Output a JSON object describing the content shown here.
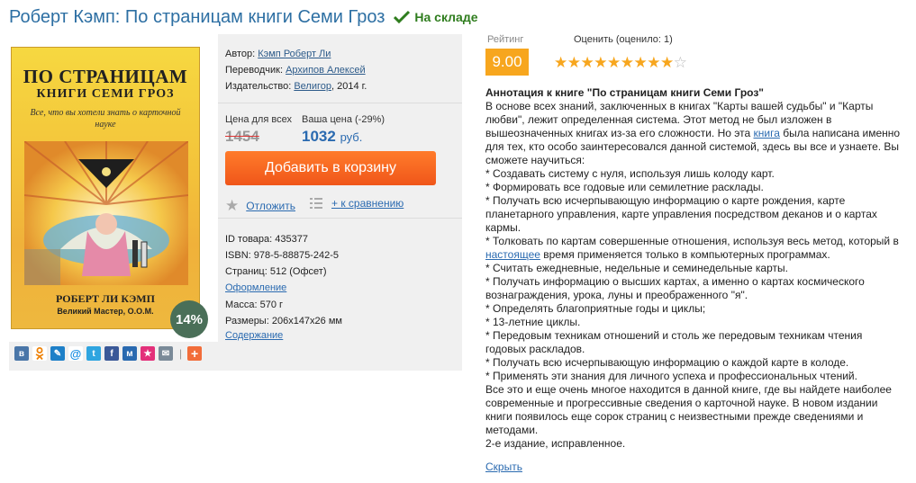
{
  "header": {
    "title": "Роберт Кэмп: По страницам книги Семи Гроз",
    "stock_status": "На складе",
    "stock_color": "#2f7d1e"
  },
  "cover": {
    "title_line1": "ПО СТРАНИЦАМ",
    "title_line2": "КНИГИ СЕМИ ГРОЗ",
    "subtitle": "Все, что вы хотели знать о карточной науке",
    "author": "РОБЕРТ ЛИ КЭМП",
    "author_title": "Великий Мастер, О.О.М.",
    "discount": "14%"
  },
  "details": {
    "author_label": "Автор:",
    "author_value": "Кэмп Роберт Ли",
    "translator_label": "Переводчик:",
    "translator_value": "Архипов Алексей",
    "publisher_label": "Издательство:",
    "publisher_value": "Велигор",
    "publisher_year": ", 2014 г."
  },
  "price": {
    "list_label": "Цена для всех",
    "your_label": "Ваша цена (-29%)",
    "old_price": "1454",
    "new_price": "1032",
    "currency": "руб.",
    "cart_button": "Добавить в корзину",
    "defer_label": "Отложить",
    "compare_label": "+ к сравнению",
    "accent_color": "#f0561a"
  },
  "specs": {
    "id_label": "ID товара:",
    "id_value": "435377",
    "isbn_label": "ISBN:",
    "isbn_value": "978-5-88875-242-5",
    "pages_label": "Страниц:",
    "pages_value": "512 (Офсет)",
    "design_link": "Оформление",
    "mass_label": "Масса:",
    "mass_value": "570 г",
    "size_label": "Размеры:",
    "size_value": "206x147x26 мм",
    "contents_link": "Содержание"
  },
  "share_icons": [
    "vk-icon",
    "odnoklassniki-icon",
    "livejournal-icon",
    "mail-at-icon",
    "twitter-icon",
    "facebook-icon",
    "moi-mir-icon",
    "bookmark-star-icon",
    "email-icon",
    "plus-icon"
  ],
  "rating": {
    "rating_label": "Рейтинг",
    "rating_value": "9.00",
    "rate_label": "Оценить (оценило: 1)",
    "stars_filled": 9,
    "stars_total": 10
  },
  "annotation": {
    "heading": "Аннотация к книге \"По страницам книги Семи Гроз\"",
    "p1": "В основе всех знаний, заключенных в книгах \"Карты вашей судьбы\" и \"Карты любви\", лежит определенная система. Этот метод не был изложен в вышеозначенных книгах из-за его сложности. Но эта ",
    "p1_link": "книга",
    "p1_tail": " была написана именно для тех, кто особо заинтересовался данной системой, здесь вы все и узнаете. Вы сможете научиться:",
    "l1": "* Создавать систему с нуля, используя лишь колоду карт.",
    "l2": "* Формировать все годовые или семилетние расклады.",
    "l3": "* Получать всю исчерпывающую информацию о карте рождения, карте планетарного управления, карте управления посредством деканов и о картах кармы.",
    "l4a": "* Толковать по картам совершенные отношения, используя весь метод, который в ",
    "l4_link": "настоящее",
    "l4b": " время применяется только в компьютерных программах.",
    "l5": "* Считать ежедневные, недельные и семинедельные карты.",
    "l6": "* Получать информацию о высших картах, а именно о картах космического вознаграждения, урока, луны и преображенного \"я\".",
    "l7": "* Определять благоприятные годы и циклы;",
    "l8": "* 13-летние циклы.",
    "l9": "* Передовым техникам отношений и столь же передовым техникам чтения годовых раскладов.",
    "l10": "* Получать всю исчерпывающую информацию о каждой карте в колоде.",
    "l11": "* Применять эти знания для личного успеха и профессиональных чтений.",
    "p2": "Все это и еще очень многое находится в данной книге, где вы найдете наиболее современные и прогрессивные сведения о карточной науке. В новом издании книги появилось еще сорок страниц с неизвестными прежде сведениями и методами.",
    "p3": "2-е издание, исправленное.",
    "hide_link": "Скрыть"
  }
}
